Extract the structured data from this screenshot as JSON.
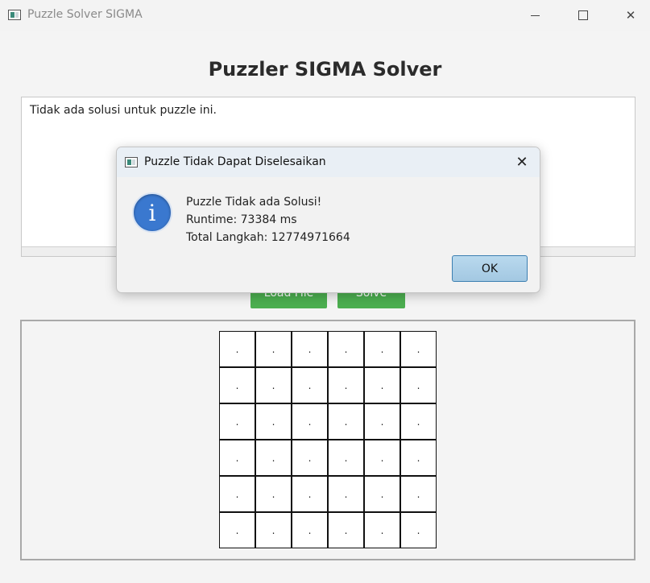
{
  "window": {
    "title": "Puzzle Solver SIGMA",
    "controls": {
      "minimize": "",
      "maximize": "",
      "close": "✕"
    }
  },
  "main": {
    "title": "Puzzler SIGMA Solver",
    "output_text": "Tidak ada solusi untuk puzzle ini.",
    "load_button": "Load File",
    "solve_button": "Solve",
    "board": {
      "rows": 6,
      "cols": 6,
      "cells": [
        [
          ".",
          ".",
          ".",
          ".",
          ".",
          "."
        ],
        [
          ".",
          ".",
          ".",
          ".",
          ".",
          "."
        ],
        [
          ".",
          ".",
          ".",
          ".",
          ".",
          "."
        ],
        [
          ".",
          ".",
          ".",
          ".",
          ".",
          "."
        ],
        [
          ".",
          ".",
          ".",
          ".",
          ".",
          "."
        ],
        [
          ".",
          ".",
          ".",
          ".",
          ".",
          "."
        ]
      ]
    }
  },
  "dialog": {
    "title": "Puzzle Tidak Dapat Diselesaikan",
    "close": "✕",
    "icon": "info-icon",
    "icon_glyph": "i",
    "message_line1": "Puzzle Tidak ada Solusi!",
    "message_line2": "Runtime: 73384 ms",
    "message_line3": "Total Langkah: 12774971664",
    "ok_label": "OK"
  },
  "colors": {
    "accent_green": "#4caf50",
    "dialog_title_bg": "#e9eff5",
    "ok_button_border": "#3c7fb1"
  }
}
